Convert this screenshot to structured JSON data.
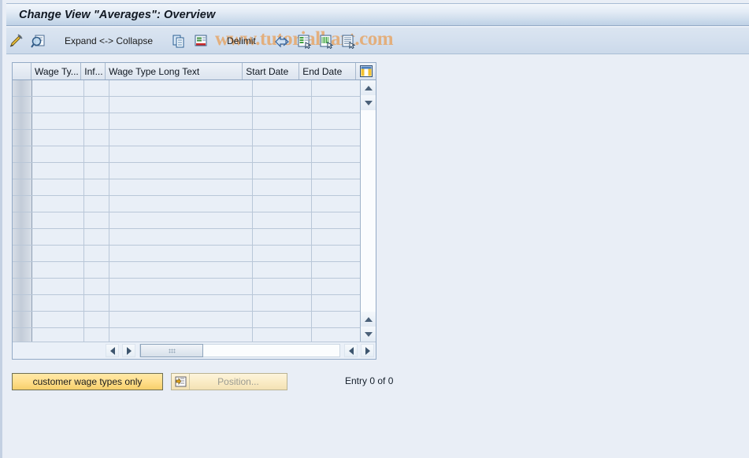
{
  "window": {
    "title": "Change View \"Averages\": Overview"
  },
  "watermark": {
    "text": "www.tutorialkart.com",
    "color": "#e6a76a"
  },
  "toolbar": {
    "items": [
      {
        "name": "change-entry-icon",
        "type": "icon",
        "label": ""
      },
      {
        "name": "display-details-icon",
        "type": "icon",
        "label": ""
      },
      {
        "name": "expand-collapse-button",
        "type": "label",
        "label": "Expand <-> Collapse"
      },
      {
        "name": "copy-as-icon",
        "type": "icon",
        "label": ""
      },
      {
        "name": "delete-row-icon",
        "type": "icon",
        "label": ""
      },
      {
        "name": "delimit-button",
        "type": "label",
        "label": "Delimit"
      },
      {
        "name": "undo-change-icon",
        "type": "icon",
        "label": ""
      },
      {
        "name": "select-all-icon",
        "type": "icon",
        "label": ""
      },
      {
        "name": "deselect-all-icon",
        "type": "icon",
        "label": ""
      },
      {
        "name": "select-block-icon",
        "type": "icon",
        "label": ""
      }
    ]
  },
  "table": {
    "columns": [
      {
        "key": "selector",
        "label": ""
      },
      {
        "key": "wage_type",
        "label": "Wage Ty..."
      },
      {
        "key": "infotype",
        "label": "Inf..."
      },
      {
        "key": "long_text",
        "label": "Wage Type Long Text"
      },
      {
        "key": "start_date",
        "label": "Start Date"
      },
      {
        "key": "end_date",
        "label": "End Date"
      }
    ],
    "rows": [],
    "empty_row_count": 16,
    "column_config_icon": "table-settings-icon"
  },
  "footer": {
    "customer_button_label": "customer wage types only",
    "position_button_label": "Position...",
    "position_button_enabled": false,
    "entry_status": "Entry 0 of 0"
  },
  "colors": {
    "page_background": "#e9eef6",
    "title_bar": "#bfd1e6",
    "accent_yellow": "#ffdf8c",
    "grid_line": "#b9c7d8"
  }
}
